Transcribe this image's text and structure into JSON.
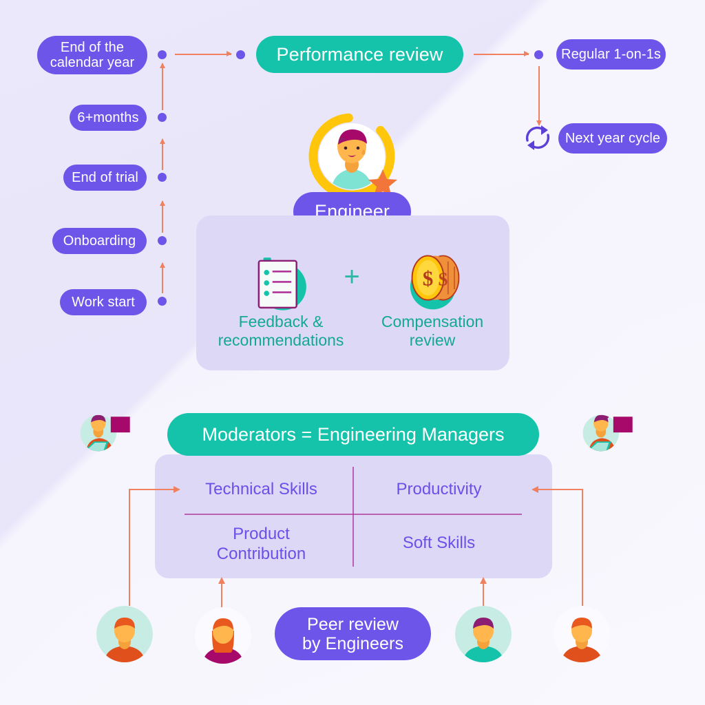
{
  "colors": {
    "background": "#ebe7fb",
    "purple": "#6c55e8",
    "teal": "#15c3ab",
    "teal_text": "#13a893",
    "quadrant_text": "#6c4fe8",
    "card": "#ded8f7",
    "arrow": "#ef8060",
    "divider": "#b0359b",
    "star": "#f2763a",
    "ring": "#ffc60b"
  },
  "timeline": {
    "items": [
      {
        "label": "End of the\ncalendar year"
      },
      {
        "label": "6+months"
      },
      {
        "label": "End of trial"
      },
      {
        "label": "Onboarding"
      },
      {
        "label": "Work start"
      }
    ]
  },
  "header": {
    "performance_review": "Performance review",
    "regular_one_on_ones": "Regular 1-on-1s",
    "next_year_cycle": "Next year cycle",
    "cycle_icon": "refresh-cycle-icon"
  },
  "engineer": {
    "label": "Engineer",
    "avatar_icon": "engineer-avatar-icon",
    "badge_icon": "star-badge-icon"
  },
  "review_card": {
    "feedback": {
      "label": "Feedback &\nrecommendations",
      "icon": "clipboard-checklist-icon"
    },
    "plus": "+",
    "compensation": {
      "label": "Compensation\nreview",
      "icon": "coins-money-icon"
    }
  },
  "moderators": {
    "banner": "Moderators = Engineering Managers",
    "manager_icon_left": "manager-with-laptop-icon",
    "manager_icon_right": "manager-with-laptop-icon",
    "quadrants": [
      {
        "label": "Technical Skills"
      },
      {
        "label": "Productivity"
      },
      {
        "label": "Product\nContribution"
      },
      {
        "label": "Soft Skills"
      }
    ]
  },
  "peer_review": {
    "label": "Peer review\nby Engineers",
    "avatars": [
      {
        "name": "peer-avatar-1",
        "circle": "#c7ece4",
        "hair": "#e8581f",
        "shirt": "#e0501c"
      },
      {
        "name": "peer-avatar-2",
        "circle": "#fbfaff",
        "hair": "#e8581f",
        "shirt": "#a6096a"
      },
      {
        "name": "peer-avatar-3",
        "circle": "#c7ece4",
        "hair": "#8c1d72",
        "shirt": "#15c3ab"
      },
      {
        "name": "peer-avatar-4",
        "circle": "#fbfaff",
        "hair": "#e8581f",
        "shirt": "#e0501c"
      }
    ]
  }
}
